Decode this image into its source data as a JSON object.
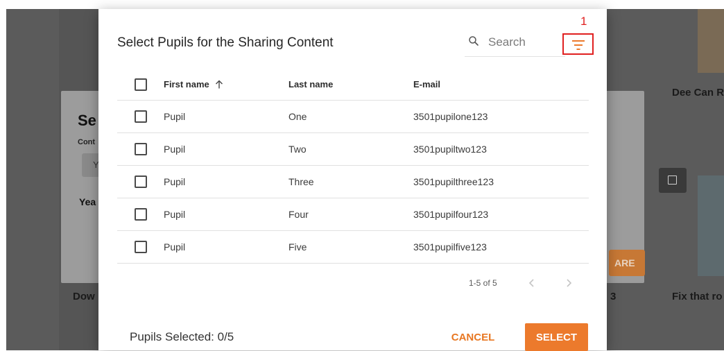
{
  "background": {
    "left_card_title_partial": "Dow",
    "dialog_title_partial": "Se",
    "dialog_sub_partial": "Cont",
    "dialog_chip_partial": "Y",
    "dialog_field_partial": "Yea",
    "share_button_partial": "ARE",
    "right_card_title_top": "Dee Can R",
    "right_card_title_bottom": "Fix that ro",
    "middle_number": "3"
  },
  "dialog": {
    "title": "Select Pupils for the Sharing Content",
    "search": {
      "placeholder": "Search",
      "value": ""
    },
    "filter_icon": "filter-list-icon",
    "annotation_label": "1"
  },
  "table": {
    "columns": [
      "First name",
      "Last name",
      "E-mail"
    ],
    "sorted_column": "First name",
    "sort_direction_icon": "arrow-up-icon",
    "rows": [
      {
        "first": "Pupil",
        "last": "One",
        "email": "3501pupilone123"
      },
      {
        "first": "Pupil",
        "last": "Two",
        "email": "3501pupiltwo123"
      },
      {
        "first": "Pupil",
        "last": "Three",
        "email": "3501pupilthree123"
      },
      {
        "first": "Pupil",
        "last": "Four",
        "email": "3501pupilfour123"
      },
      {
        "first": "Pupil",
        "last": "Five",
        "email": "3501pupilfive123"
      }
    ]
  },
  "pagination": {
    "range": "1-5 of 5"
  },
  "footer": {
    "selected_count": "Pupils Selected: 0/5",
    "cancel_label": "CANCEL",
    "select_label": "SELECT"
  },
  "colors": {
    "accent": "#ec7a2c",
    "annotation": "#e02020",
    "backdrop": "#5b5b5b"
  }
}
